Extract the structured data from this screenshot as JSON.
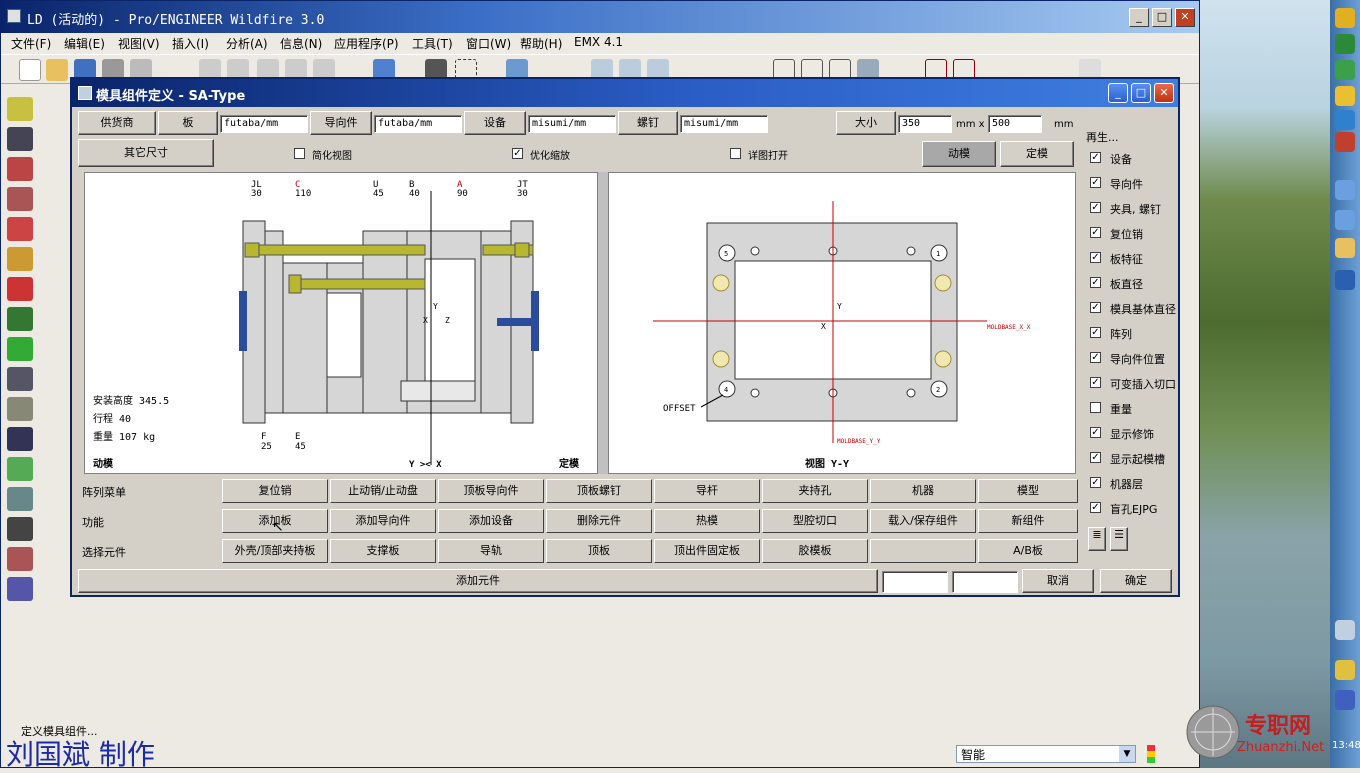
{
  "window": {
    "title": "LD (活动的) - Pro/ENGINEER Wildfire 3.0",
    "minimize": "_",
    "maximize": "□",
    "close": "✕"
  },
  "menu": [
    "文件(F)",
    "编辑(E)",
    "视图(V)",
    "插入(I)",
    "分析(A)",
    "信息(N)",
    "应用程序(P)",
    "工具(T)",
    "窗口(W)",
    "帮助(H)",
    "EMX 4.1"
  ],
  "status_message": "定义模具组件...",
  "author_caption": "刘国斌 制作",
  "smart_filter": "智能",
  "watermark": {
    "brand": "专职网",
    "url": "Zhuanzhi.Net"
  },
  "tray_time": "13:48",
  "dialog": {
    "title": "模具组件定义 - SA-Type",
    "top_row": {
      "supplier_label": "供货商",
      "plate_label": "板",
      "plate_value": "futaba/mm",
      "guide_label": "导向件",
      "guide_value": "futaba/mm",
      "equip_label": "设备",
      "equip_value": "misumi/mm",
      "screw_label": "螺钉",
      "screw_value": "misumi/mm",
      "size_label": "大小",
      "size_x": "350",
      "unit_x": "mm x",
      "size_y": "500",
      "unit_y": "mm"
    },
    "second_row": {
      "other_dims": "其它尺寸",
      "simplified_view": "简化视图",
      "optimize_zoom": "优化缩放",
      "detail_open": "详图打开",
      "moving": "动模",
      "fixed": "定模"
    },
    "left_view": {
      "labels_top": [
        {
          "name": "JL",
          "value": "30"
        },
        {
          "name": "C",
          "value": "110"
        },
        {
          "name": "U",
          "value": "45"
        },
        {
          "name": "B",
          "value": "40"
        },
        {
          "name": "A",
          "value": "90"
        },
        {
          "name": "JT",
          "value": "30"
        }
      ],
      "labels_bottom": [
        {
          "name": "F",
          "value": "25"
        },
        {
          "name": "E",
          "value": "45"
        }
      ],
      "install_height": "安装高度 345.5",
      "stroke": "行程 40",
      "weight": "重量 107 kg",
      "side_left": "动模",
      "axis_label": "Y >< X",
      "side_right": "定模"
    },
    "right_view": {
      "offset": "OFFSET",
      "mark_x": "MOLDBASE_X_X",
      "mark_y": "MOLDBASE_Y_Y",
      "view_label": "视图 Y-Y",
      "corners": [
        "5",
        "1",
        "4",
        "2"
      ]
    },
    "rows": [
      {
        "label": "阵列菜单",
        "buttons": [
          "复位销",
          "止动销/止动盘",
          "顶板导向件",
          "顶板螺钉",
          "导杆",
          "夹持孔",
          "机器",
          "模型"
        ]
      },
      {
        "label": "功能",
        "buttons": [
          "添加板",
          "添加导向件",
          "添加设备",
          "删除元件",
          "热模",
          "型腔切口",
          "载入/保存组件",
          "新组件"
        ]
      },
      {
        "label": "选择元件",
        "buttons": [
          "外壳/顶部夹持板",
          "支撑板",
          "导轨",
          "顶板",
          "顶出件固定板",
          "胶模板",
          "",
          "A/B板"
        ]
      }
    ],
    "footer": {
      "add_component": "添加元件",
      "cancel": "取消",
      "ok": "确定"
    },
    "options": {
      "title": "再生...",
      "items": [
        {
          "label": "设备",
          "checked": true
        },
        {
          "label": "导向件",
          "checked": true
        },
        {
          "label": "夹具, 螺钉",
          "checked": true
        },
        {
          "label": "复位销",
          "checked": true
        },
        {
          "label": "板特征",
          "checked": true
        },
        {
          "label": "板直径",
          "checked": true
        },
        {
          "label": "模具基体直径",
          "checked": true
        },
        {
          "label": "阵列",
          "checked": true
        },
        {
          "label": "导向件位置",
          "checked": true
        },
        {
          "label": "可变插入切口",
          "checked": true
        },
        {
          "label": "重量",
          "checked": false
        },
        {
          "label": "显示修饰",
          "checked": true
        },
        {
          "label": "显示起模槽",
          "checked": true
        },
        {
          "label": "机器层",
          "checked": true
        },
        {
          "label": "盲孔EJPG",
          "checked": true
        }
      ]
    }
  },
  "colors": {
    "title_blue": "#0a246a",
    "plate_gray": "#d6d6d6",
    "guide_yellow": "#b8b830",
    "clamp_blue": "#2a4c9a",
    "axis_red": "#c00000",
    "author_blue": "#1a2aa8"
  }
}
